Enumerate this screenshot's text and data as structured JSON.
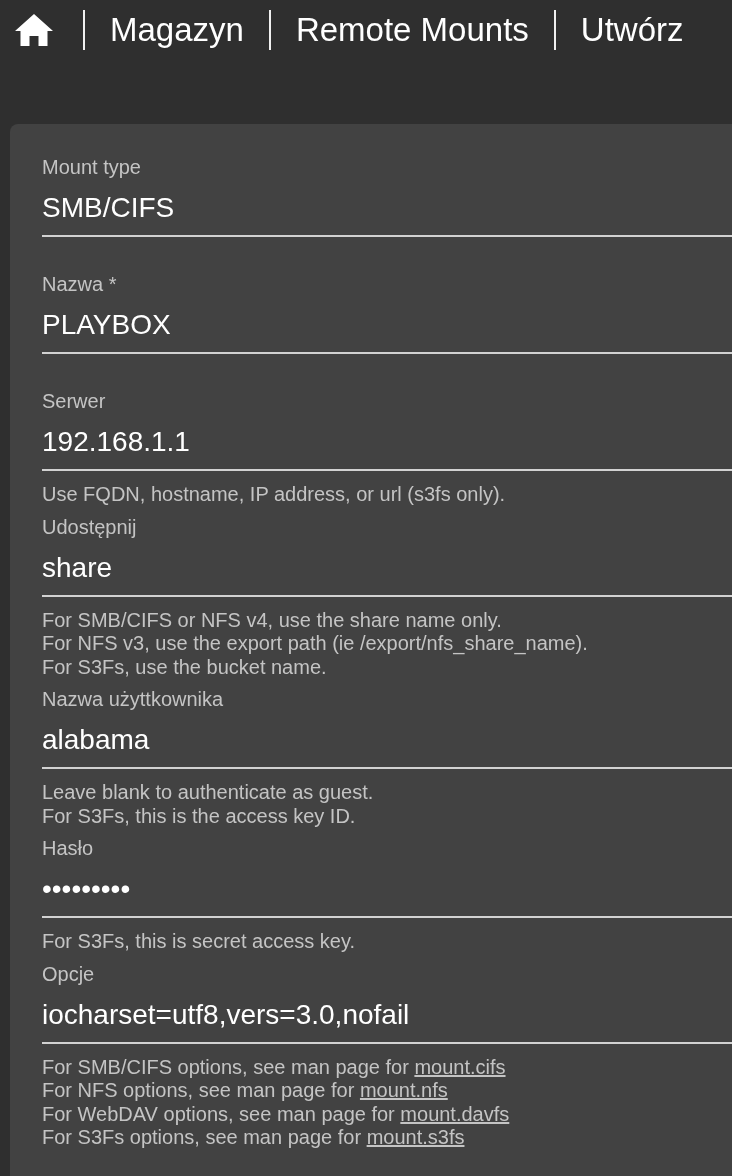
{
  "breadcrumb": [
    {
      "label": "Magazyn"
    },
    {
      "label": "Remote Mounts"
    },
    {
      "label": "Utwórz"
    }
  ],
  "form": {
    "fields": [
      {
        "label": "Mount type",
        "value": "SMB/CIFS"
      },
      {
        "label": "Nazwa *",
        "value": "PLAYBOX"
      },
      {
        "label": "Serwer",
        "value": "192.168.1.1",
        "help": [
          {
            "text": "Use FQDN, hostname, IP address, or url (s3fs only)."
          }
        ]
      },
      {
        "label": "Udostępnij",
        "value": "share",
        "help": [
          {
            "text": "For SMB/CIFS or NFS v4, use the share name only."
          },
          {
            "text": "For NFS v3, use the export path (ie /export/nfs_share_name)."
          },
          {
            "text": "For S3Fs, use the bucket name."
          }
        ]
      },
      {
        "label": "Nazwa użyttkownika",
        "value": "alabama",
        "help": [
          {
            "text": "Leave blank to authenticate as guest."
          },
          {
            "text": "For S3Fs, this is the access key ID."
          }
        ]
      },
      {
        "label": "Hasło",
        "value": "•••••••••",
        "help": [
          {
            "text": "For S3Fs, this is secret access key."
          }
        ]
      },
      {
        "label": "Opcje",
        "value": "iocharset=utf8,vers=3.0,nofail",
        "help": [
          {
            "text": "For SMB/CIFS options, see man page for",
            "link": "mount.cifs"
          },
          {
            "text": "For NFS options, see man page for",
            "link": "mount.nfs"
          },
          {
            "text": "For WebDAV options, see man page for",
            "link": "mount.davfs"
          },
          {
            "text": "For S3Fs options, see man page for",
            "link": "mount.s3fs"
          }
        ]
      }
    ]
  }
}
